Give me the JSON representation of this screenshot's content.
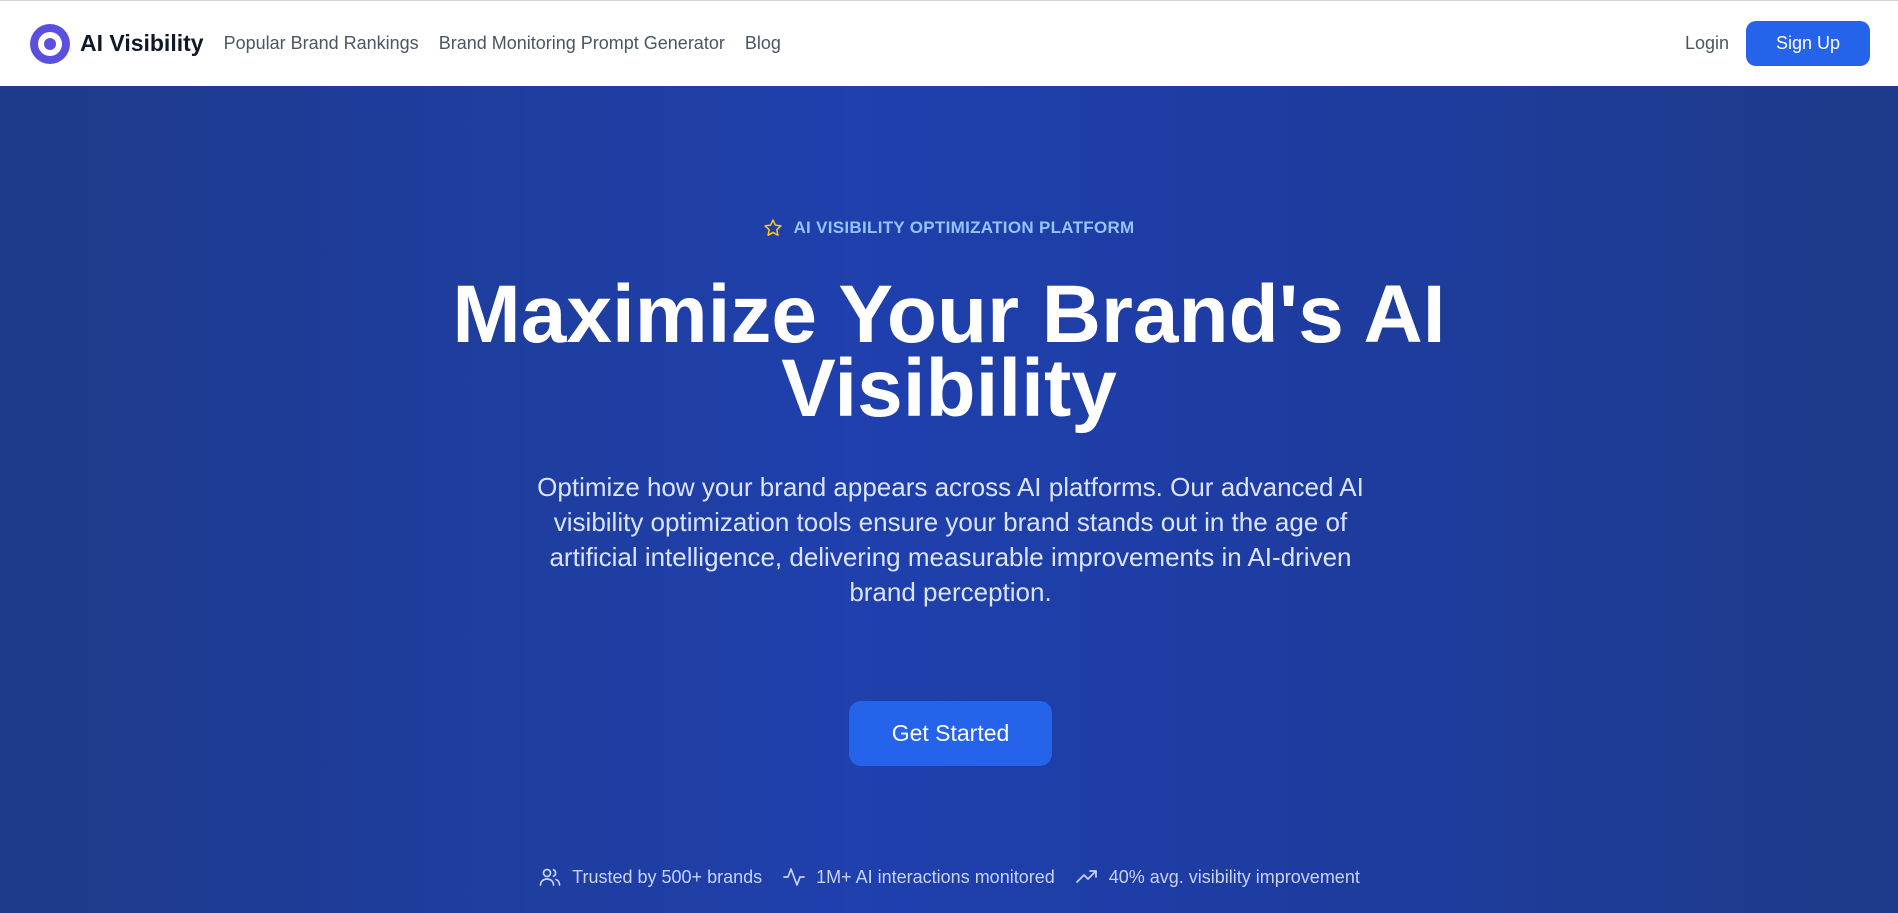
{
  "header": {
    "brand_name": "AI Visibility",
    "nav": [
      {
        "label": "Popular Brand Rankings"
      },
      {
        "label": "Brand Monitoring Prompt Generator"
      },
      {
        "label": "Blog"
      }
    ],
    "login_label": "Login",
    "signup_label": "Sign Up"
  },
  "hero": {
    "eyebrow": "AI VISIBILITY OPTIMIZATION PLATFORM",
    "headline_line1": "Maximize Your Brand's AI",
    "headline_line2": "Visibility",
    "subhead": "Optimize how your brand appears across AI platforms. Our advanced AI visibility optimization tools ensure your brand stands out in the age of artificial intelligence, delivering measurable improvements in AI-driven brand perception.",
    "cta_label": "Get Started"
  },
  "stats": [
    {
      "icon": "users-icon",
      "text": "Trusted by 500+ brands"
    },
    {
      "icon": "activity-icon",
      "text": "1M+ AI interactions monitored"
    },
    {
      "icon": "trending-up-icon",
      "text": "40% avg. visibility improvement"
    }
  ],
  "colors": {
    "brand_purple": "#5b4fe0",
    "primary_blue": "#2563eb",
    "hero_bg": "#1f40ad",
    "eyebrow_text": "#93c5fd",
    "star_yellow": "#facc15"
  }
}
